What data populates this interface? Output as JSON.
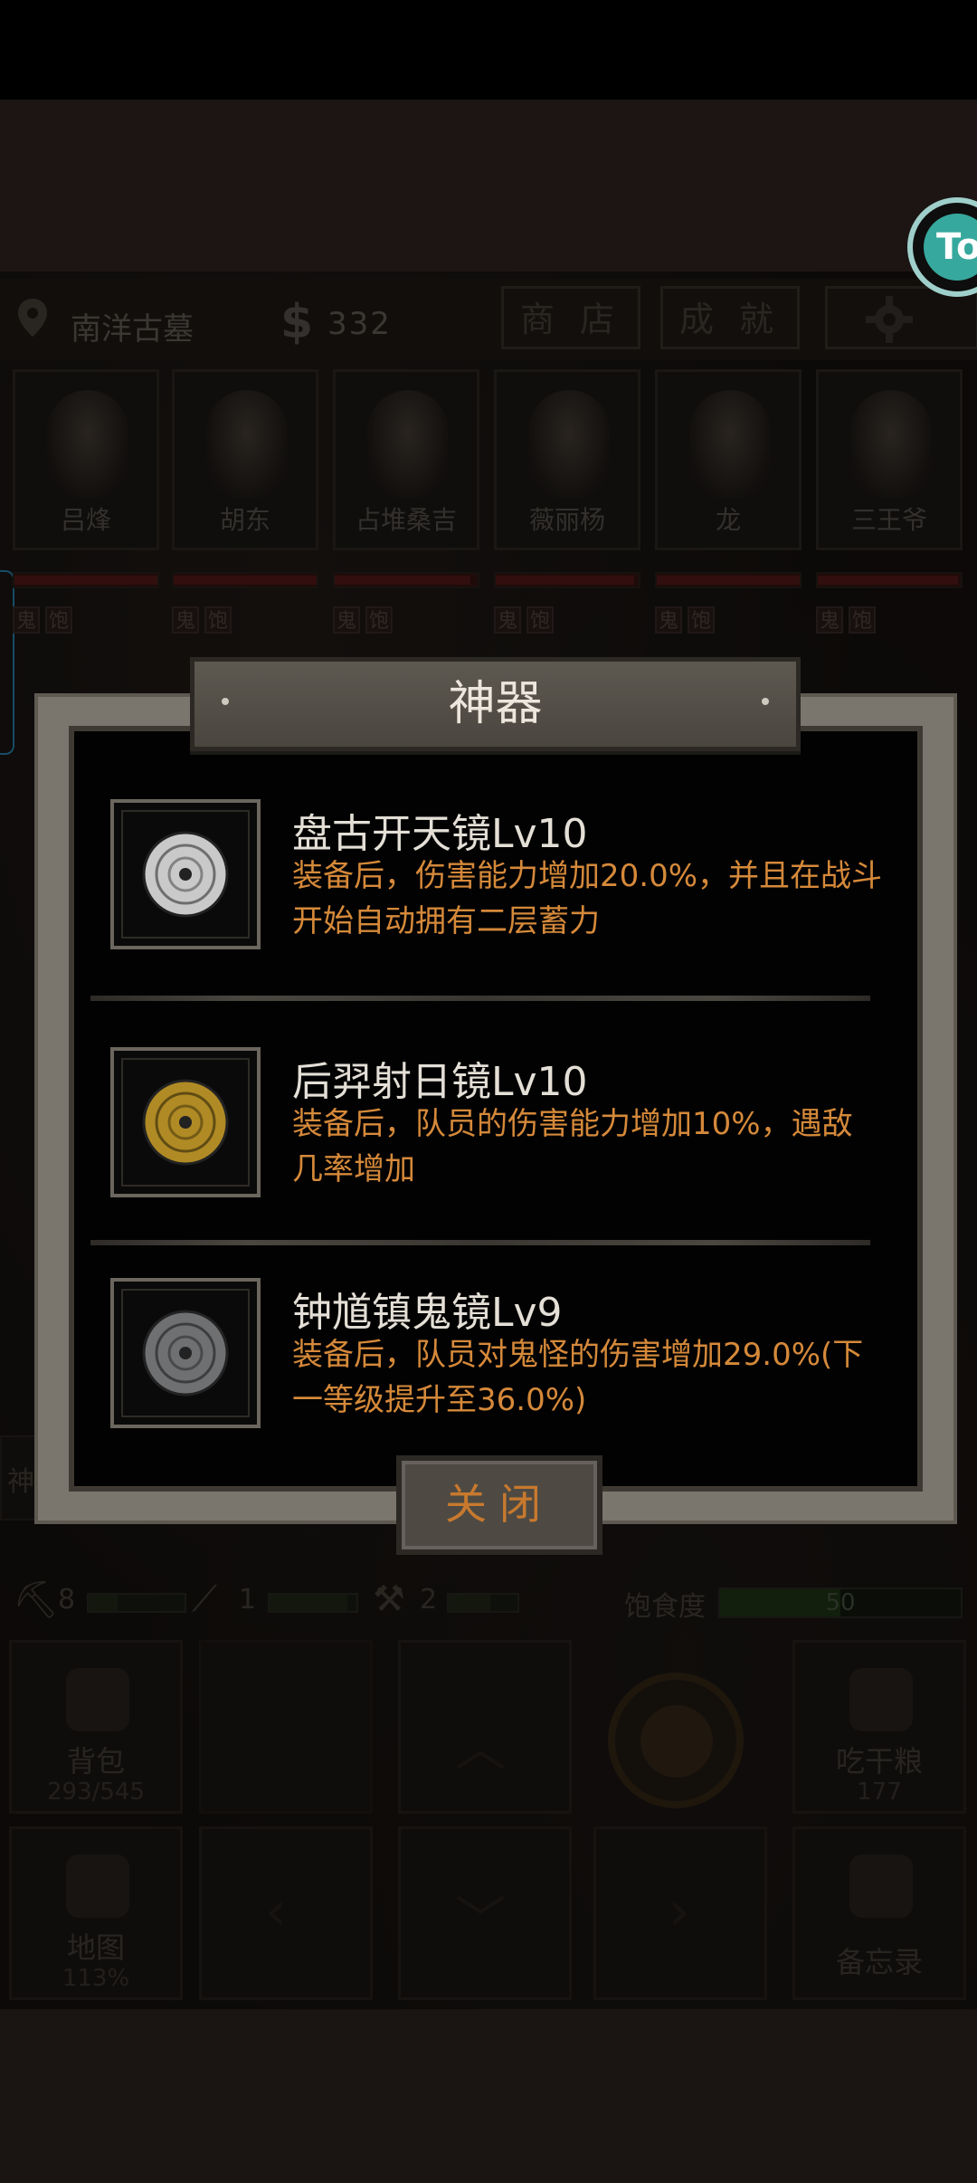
{
  "hud": {
    "location": "南洋古墓",
    "money_symbol": "$",
    "money": "332",
    "shop_label": "商 店",
    "achievement_label": "成 就",
    "badge_text": "To"
  },
  "characters": [
    {
      "name": "吕烽",
      "hp": 1.0
    },
    {
      "name": "胡东",
      "hp": 1.0
    },
    {
      "name": "占堆桑吉",
      "hp": 0.95
    },
    {
      "name": "薇丽杨",
      "hp": 0.97
    },
    {
      "name": "龙",
      "hp": 1.0
    },
    {
      "name": "三王爷",
      "hp": 0.98
    }
  ],
  "status_tags": [
    "鬼",
    "饱"
  ],
  "side_tab": "神",
  "resources": {
    "axe": "8",
    "rope": "1",
    "shovel": "2",
    "hunger_label": "饱食度",
    "hunger_value": "50",
    "hunger_level": 0.5
  },
  "tiles": {
    "bag_label": "背包",
    "bag_count": "293/545",
    "eat_label": "吃干粮",
    "eat_count": "177",
    "map_label": "地图",
    "map_percent": "113%",
    "memo_label": "备忘录"
  },
  "dialog": {
    "title": "神器",
    "items": [
      {
        "name": "盘古开天镜Lv10",
        "desc_1": "装备后，伤害能力增加20.0%，并且在战斗",
        "desc_2": "开始自动拥有二层蓄力",
        "color": "#c9c9c9"
      },
      {
        "name": "后羿射日镜Lv10",
        "desc_1": "装备后，队员的伤害能力增加10%，遇敌",
        "desc_2": "几率增加",
        "color": "#b08a24"
      },
      {
        "name": "钟馗镇鬼镜Lv9",
        "desc_1": "装备后，队员对鬼怪的伤害增加29.0%(下",
        "desc_2": "一等级提升至36.0%)",
        "color": "#6f7071"
      }
    ],
    "close_label": "关闭",
    "colors": {
      "name": "#e4dfd6",
      "desc": "#d5893a",
      "close": "#c8792e"
    }
  }
}
